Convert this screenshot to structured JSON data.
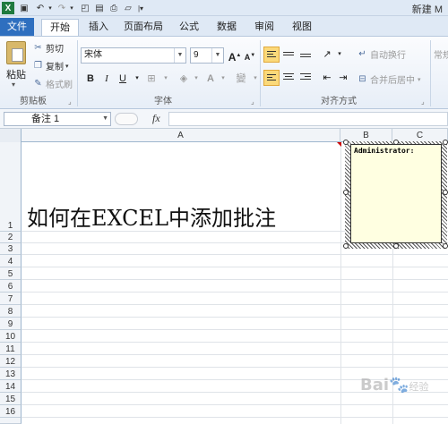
{
  "app": {
    "title": "新建 M",
    "quick_access": [
      "excel-logo-icon",
      "save-icon",
      "undo-icon",
      "redo-icon",
      "print-preview-icon",
      "spelling-icon",
      "print-icon",
      "open-icon",
      "customize-icon"
    ]
  },
  "tabs": [
    "文件",
    "开始",
    "插入",
    "页面布局",
    "公式",
    "数据",
    "审阅",
    "视图"
  ],
  "active_tab": "开始",
  "ribbon": {
    "clipboard": {
      "paste": "粘贴",
      "cut": "剪切",
      "copy": "复制",
      "format_painter": "格式刷",
      "group_label": "剪贴板"
    },
    "font": {
      "font_name": "宋体",
      "font_size": "9",
      "grow": "A",
      "shrink": "A",
      "bold": "B",
      "italic": "I",
      "underline": "U",
      "wen": "變",
      "group_label": "字体"
    },
    "alignment": {
      "wrap_text": "自动换行",
      "merge_center": "合并后居中",
      "group_label": "对齐方式"
    },
    "number_partial": "常规"
  },
  "formula_bar": {
    "name_box": "备注 1",
    "fx": "fx",
    "formula": ""
  },
  "grid": {
    "columns": [
      "A",
      "B",
      "C"
    ],
    "rows": [
      "1",
      "2",
      "3",
      "4",
      "5",
      "6",
      "7",
      "8",
      "9",
      "10",
      "11",
      "12",
      "13",
      "14",
      "15",
      "16"
    ],
    "cell_a1": "如何在EXCEL中添加批注"
  },
  "comment": {
    "author": "Administrator:",
    "body": ""
  },
  "watermark": {
    "text": "Bai",
    "suffix": "经验"
  },
  "colors": {
    "file_tab": "#2e6fbf",
    "highlight": "#fbd97a",
    "comment_bg": "#ffffe1",
    "comment_indicator": "#cc0000"
  }
}
